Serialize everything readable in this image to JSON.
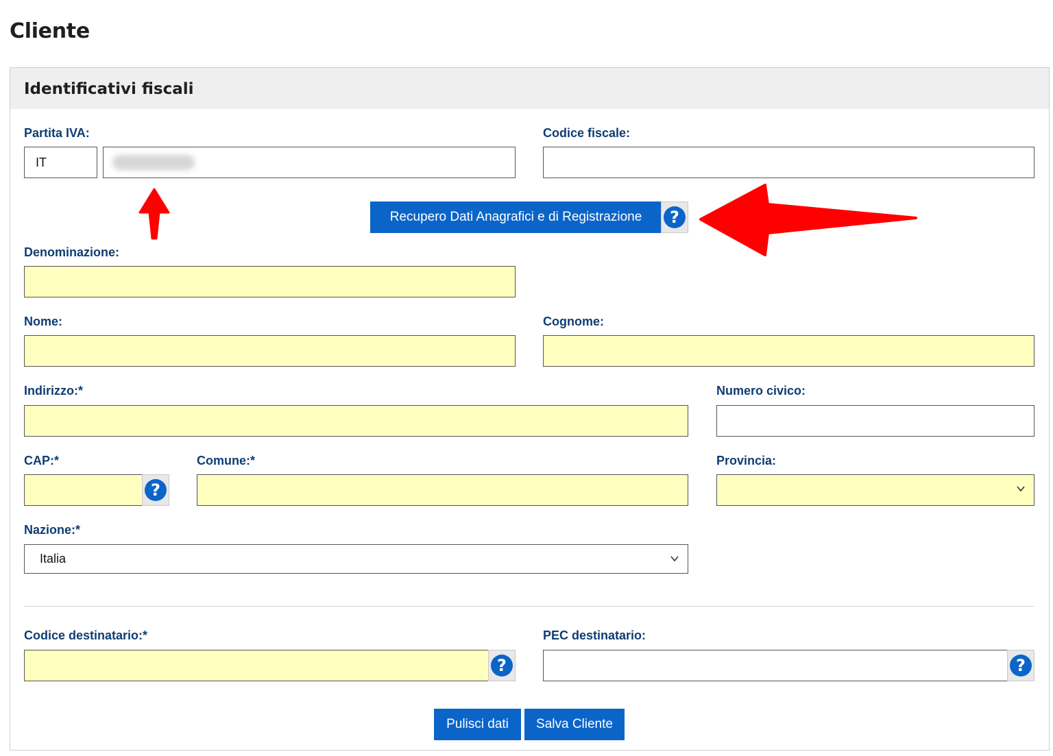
{
  "page": {
    "title": "Cliente"
  },
  "section": {
    "title": "Identificativi fiscali"
  },
  "fields": {
    "partita_iva": {
      "label": "Partita IVA:",
      "prefix": "IT",
      "value": ""
    },
    "codice_fiscale": {
      "label": "Codice fiscale:",
      "value": ""
    },
    "denominazione": {
      "label": "Denominazione:",
      "value": ""
    },
    "nome": {
      "label": "Nome:",
      "value": ""
    },
    "cognome": {
      "label": "Cognome:",
      "value": ""
    },
    "indirizzo": {
      "label": "Indirizzo:*",
      "value": ""
    },
    "numero_civico": {
      "label": "Numero civico:",
      "value": ""
    },
    "cap": {
      "label": "CAP:*",
      "value": ""
    },
    "comune": {
      "label": "Comune:*",
      "value": ""
    },
    "provincia": {
      "label": "Provincia:",
      "selected": ""
    },
    "nazione": {
      "label": "Nazione:*",
      "selected": "Italia"
    },
    "codice_destinatario": {
      "label": "Codice destinatario:*",
      "value": ""
    },
    "pec_destinatario": {
      "label": "PEC destinatario:",
      "value": ""
    }
  },
  "buttons": {
    "recupero": "Recupero Dati Anagrafici e di Registrazione",
    "help_glyph": "?",
    "pulisci": "Pulisci dati",
    "salva": "Salva Cliente"
  },
  "colors": {
    "label": "#0f3d73",
    "primary": "#0b65c8",
    "required_field": "#ffffc0",
    "annotation_arrow": "#ff0000"
  },
  "icons": [
    "help-icon",
    "chevron-down-icon",
    "annotation-arrow-up",
    "annotation-arrow-left"
  ]
}
